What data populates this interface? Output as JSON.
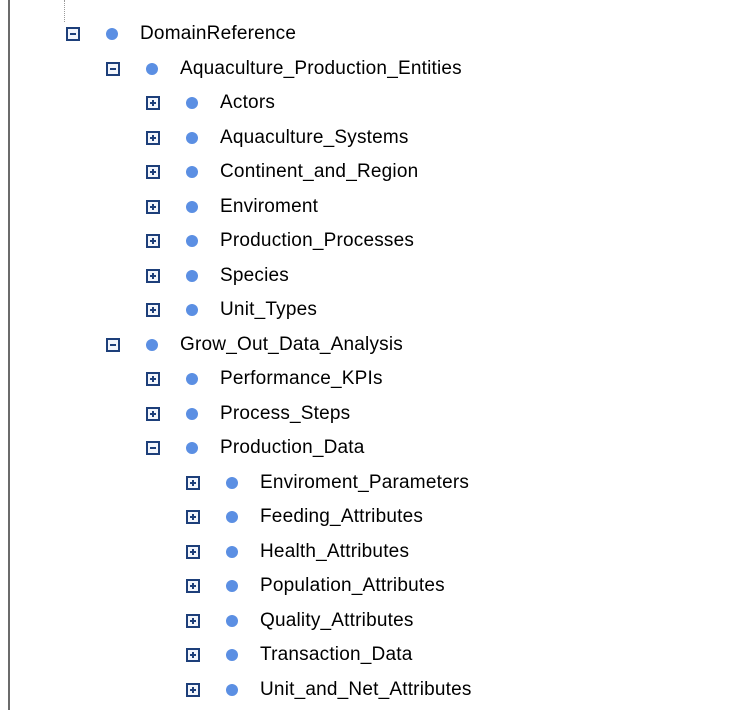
{
  "tree": {
    "root": {
      "label": "DomainReference",
      "state": "expanded",
      "icon": "node-dot-icon",
      "dot_color": "#5b8fe3"
    },
    "group1": {
      "label": "Aquaculture_Production_Entities",
      "state": "expanded",
      "children": [
        {
          "label": "Actors",
          "state": "collapsed"
        },
        {
          "label": "Aquaculture_Systems",
          "state": "collapsed"
        },
        {
          "label": "Continent_and_Region",
          "state": "collapsed"
        },
        {
          "label": "Enviroment",
          "state": "collapsed"
        },
        {
          "label": "Production_Processes",
          "state": "collapsed"
        },
        {
          "label": "Species",
          "state": "collapsed"
        },
        {
          "label": "Unit_Types",
          "state": "collapsed"
        }
      ]
    },
    "group2": {
      "label": "Grow_Out_Data_Analysis",
      "state": "expanded",
      "children": [
        {
          "label": "Performance_KPIs",
          "state": "collapsed"
        },
        {
          "label": "Process_Steps",
          "state": "collapsed"
        },
        {
          "label": "Production_Data",
          "state": "expanded",
          "children": [
            {
              "label": "Enviroment_Parameters",
              "state": "collapsed"
            },
            {
              "label": "Feeding_Attributes",
              "state": "collapsed"
            },
            {
              "label": "Health_Attributes",
              "state": "collapsed"
            },
            {
              "label": "Population_Attributes",
              "state": "collapsed"
            },
            {
              "label": "Quality_Attributes",
              "state": "collapsed"
            },
            {
              "label": "Transaction_Data",
              "state": "collapsed"
            },
            {
              "label": "Unit_and_Net_Attributes",
              "state": "collapsed"
            }
          ]
        }
      ]
    }
  }
}
